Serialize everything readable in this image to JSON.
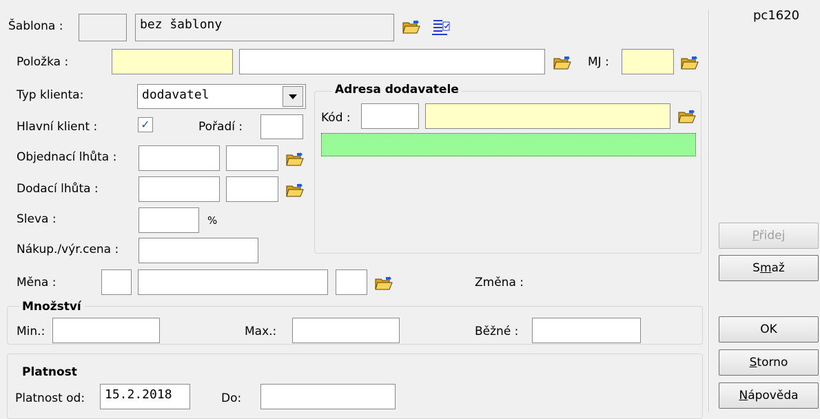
{
  "window_id": "pc1620",
  "sablona": {
    "label": "Šablona :",
    "code": "",
    "name": "bez šablony"
  },
  "polozka": {
    "label": "Položka :",
    "code": "",
    "name": "",
    "mj_label": "MJ :",
    "mj_value": ""
  },
  "typ_klienta": {
    "label": "Typ klienta:",
    "value": "dodavatel"
  },
  "hlavni_klient": {
    "label": "Hlavní klient :",
    "checked": true,
    "check_glyph": "✓"
  },
  "poradi": {
    "label": "Pořadí :",
    "value": ""
  },
  "objednaci_lhuta": {
    "label": "Objednací lhůta :",
    "value1": "",
    "value2": ""
  },
  "dodaci_lhuta": {
    "label": "Dodací lhůta :",
    "value1": "",
    "value2": ""
  },
  "sleva": {
    "label": "Sleva :",
    "value": "",
    "unit": "%"
  },
  "nakup_cena": {
    "label": "Nákup./výr.cena :",
    "value": ""
  },
  "mena": {
    "label": "Měna :",
    "code": "",
    "name": "",
    "extra": ""
  },
  "zmena": {
    "label": "Změna :"
  },
  "adresa": {
    "title": "Adresa dodavatele",
    "kod_label": "Kód :",
    "kod_value": "",
    "name": "",
    "address": ""
  },
  "mnozstvi": {
    "title": "Množství",
    "min_label": "Min.:",
    "min": "",
    "max_label": "Max.:",
    "max": "",
    "bezne_label": "Běžné :",
    "bezne": ""
  },
  "platnost": {
    "title": "Platnost",
    "od_label": "Platnost od:",
    "od": "15.2.2018",
    "do_label": "Do:",
    "do": ""
  },
  "buttons": {
    "pridej": {
      "pre": "",
      "ul": "P",
      "post": "řidej"
    },
    "smaz": {
      "pre": "S",
      "ul": "m",
      "post": "až"
    },
    "ok": {
      "label": "OK"
    },
    "storno": {
      "pre": "",
      "ul": "S",
      "post": "torno"
    },
    "napoveda": {
      "pre": "",
      "ul": "N",
      "post": "ápověda"
    }
  },
  "colors": {
    "required_yellow": "#ffffc8",
    "address_green": "#98fb98",
    "folder": "#f2c94c"
  }
}
